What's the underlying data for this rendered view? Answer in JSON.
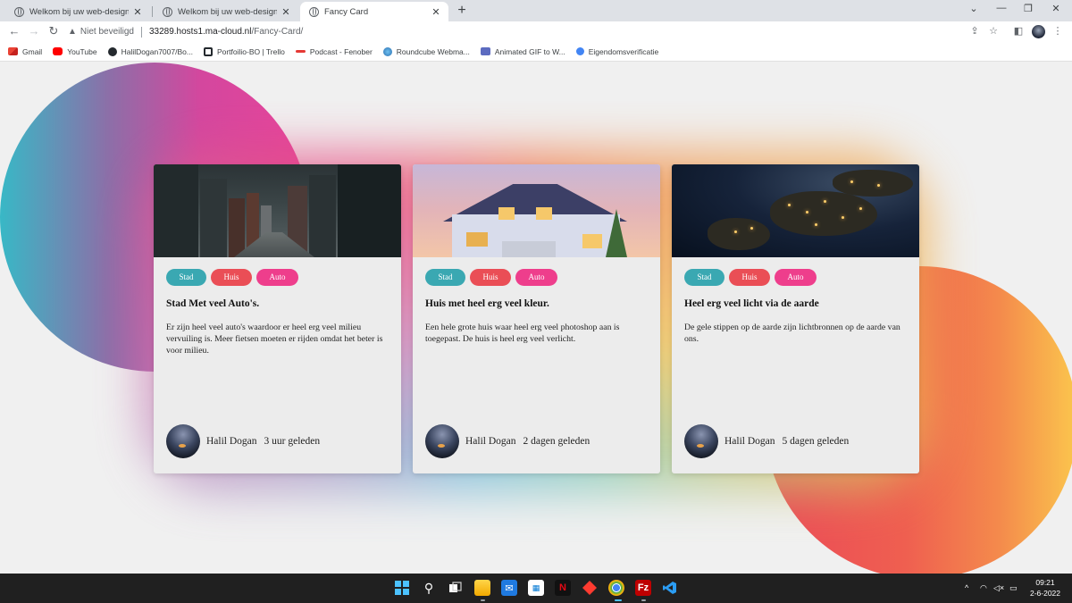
{
  "browser": {
    "tabs": [
      {
        "title": "Welkom bij uw web-design webs",
        "active": false
      },
      {
        "title": "Welkom bij uw web-design webs",
        "active": false
      },
      {
        "title": "Fancy Card",
        "active": true
      }
    ],
    "new_tab_symbol": "+",
    "window_controls": [
      "⌄",
      "—",
      "❐",
      "✕"
    ],
    "security_label": "Niet beveiligd",
    "url_host": "33289.hosts1.ma-cloud.nl",
    "url_path": "/Fancy-Card/",
    "bookmarks": [
      {
        "label": "Gmail",
        "icon": "gmail-icon",
        "color": "#ea4335"
      },
      {
        "label": "YouTube",
        "icon": "youtube-icon",
        "color": "#ff0000"
      },
      {
        "label": "HalilDogan7007/Bo...",
        "icon": "github-icon",
        "color": "#24292e"
      },
      {
        "label": "Portfoilio-BO | Trello",
        "icon": "trello-icon",
        "color": "#24292e"
      },
      {
        "label": "Podcast - Fenober",
        "icon": "podcast-icon",
        "color": "#e53935"
      },
      {
        "label": "Roundcube Webma...",
        "icon": "roundcube-icon",
        "color": "#3a8ed0"
      },
      {
        "label": "Animated GIF to W...",
        "icon": "gif-icon",
        "color": "#5c6bc0"
      },
      {
        "label": "Eigendomsverificatie",
        "icon": "verification-icon",
        "color": "#4285f4"
      }
    ]
  },
  "cards": [
    {
      "image": "city-street-photo",
      "tags": [
        "Stad",
        "Huis",
        "Auto"
      ],
      "title": "Stad Met veel Auto's.",
      "text": "Er zijn heel veel auto's waardoor er heel erg veel milieu vervuiling is. Meer fietsen moeten er rijden omdat het beter is voor milieu.",
      "author": "Halil Dogan",
      "time": "3 uur geleden"
    },
    {
      "image": "house-photo",
      "tags": [
        "Stad",
        "Huis",
        "Auto"
      ],
      "title": "Huis met heel erg veel kleur.",
      "text": "Een hele grote huis waar heel erg veel photoshop aan is toegepast. De huis is heel erg veel verlicht.",
      "author": "Halil Dogan",
      "time": "2 dagen geleden"
    },
    {
      "image": "earth-at-night-photo",
      "tags": [
        "Stad",
        "Huis",
        "Auto"
      ],
      "title": "Heel erg veel licht via de aarde",
      "text": "De gele stippen op de aarde zijn lichtbronnen op de aarde van ons.",
      "author": "Halil Dogan",
      "time": "5 dagen geleden"
    }
  ],
  "colors": {
    "tag_stad": "#3aa8b2",
    "tag_huis": "#ea4e56",
    "tag_auto": "#ee3e8c",
    "blob_left": "#d4479e",
    "blob_right": "#ef5f50"
  },
  "taskbar": {
    "time": "09:21",
    "date": "2-6-2022",
    "apps": [
      "windows-start-icon",
      "search-icon",
      "task-view-icon",
      "file-explorer-icon",
      "mail-icon",
      "store-icon",
      "netflix-icon",
      "app-icon",
      "chrome-icon",
      "filezilla-icon",
      "vscode-icon"
    ]
  }
}
